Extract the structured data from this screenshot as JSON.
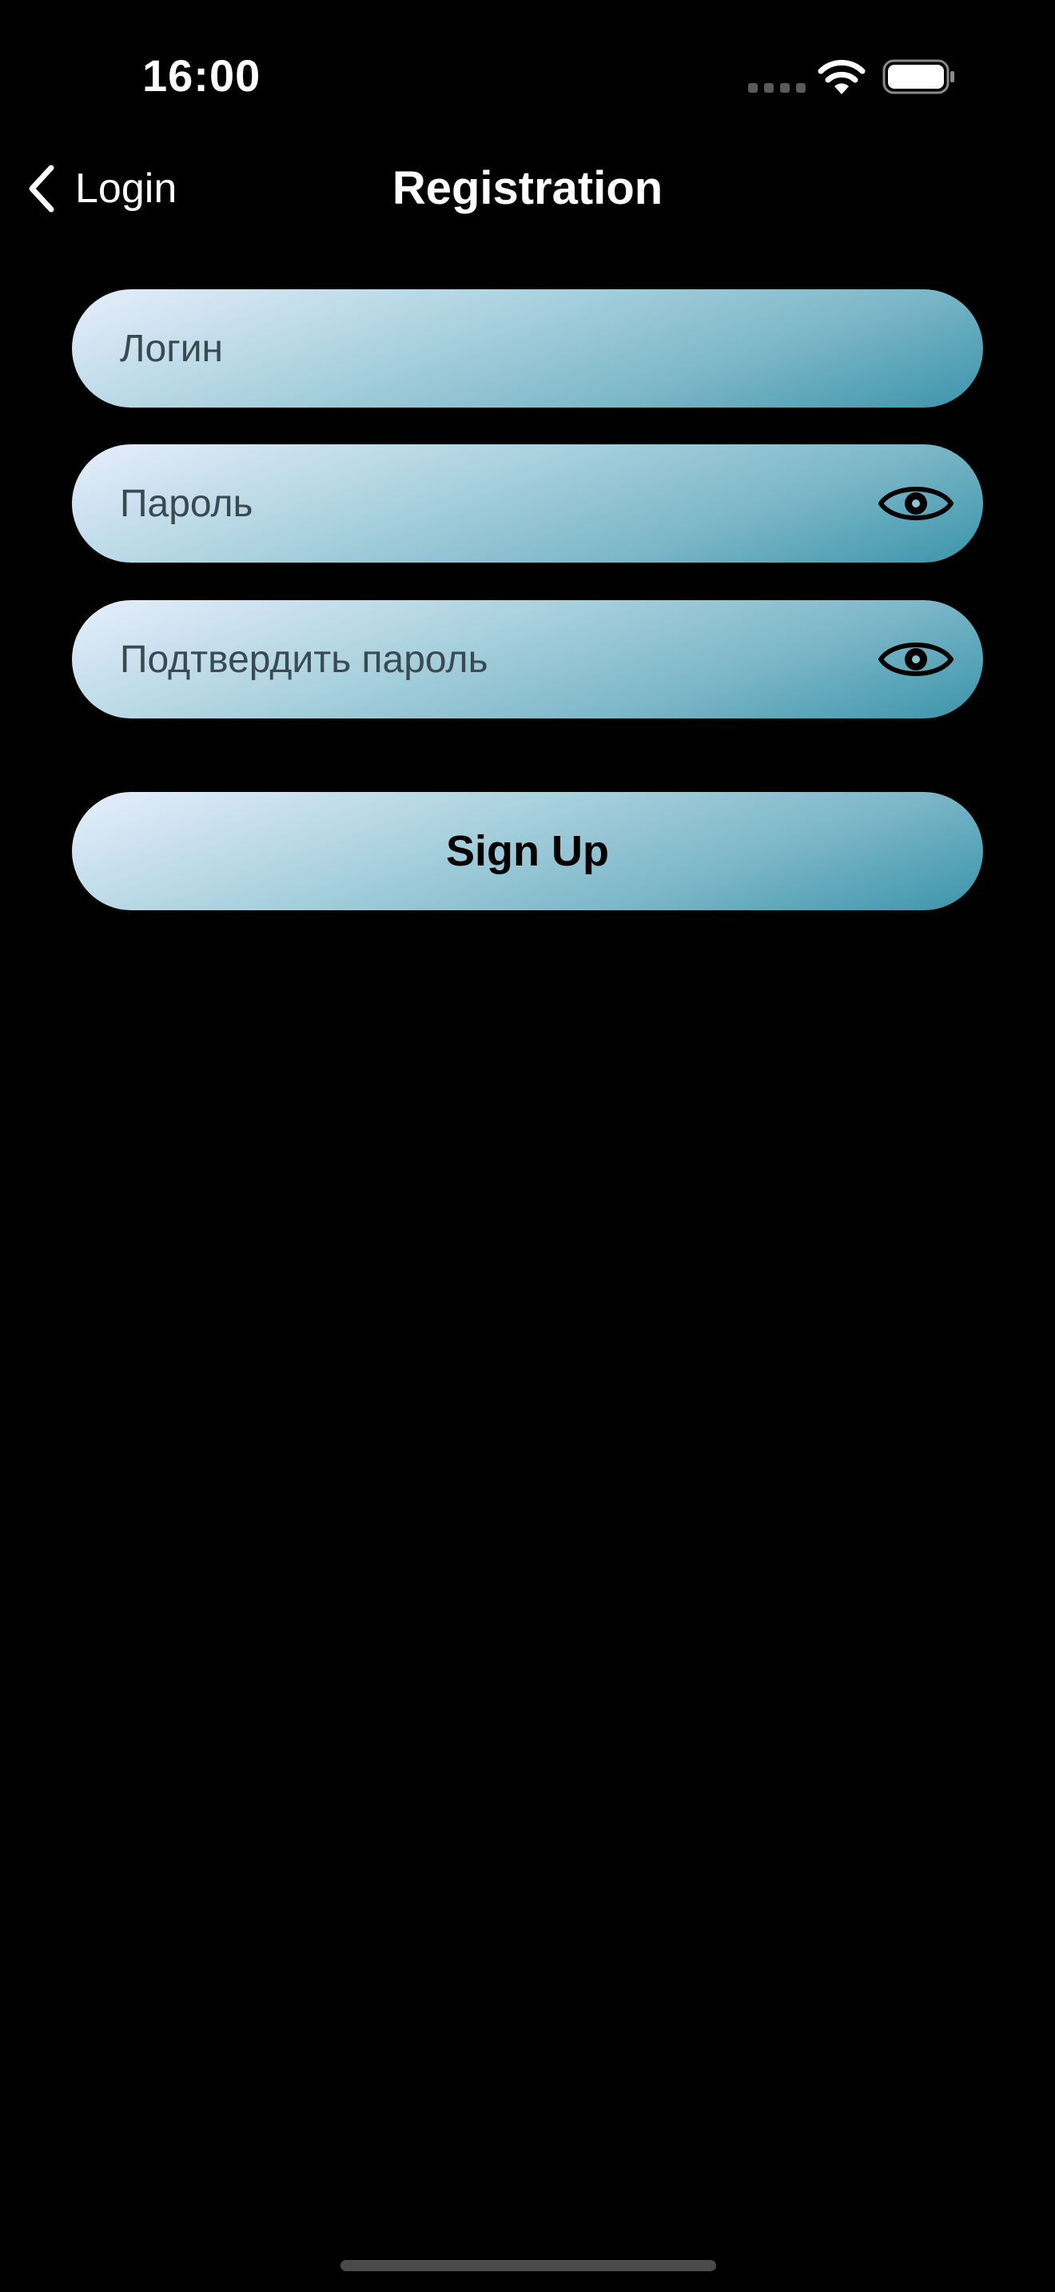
{
  "status_bar": {
    "time": "16:00",
    "colors": {
      "text": "#ffffff",
      "signal_inactive": "#5a5a5a"
    },
    "icons": [
      "cellular-signal-icon",
      "wifi-icon",
      "battery-icon"
    ]
  },
  "nav": {
    "back_label": "Login",
    "back_icon": "chevron-left-icon",
    "title": "Registration"
  },
  "form": {
    "login_placeholder": "Логин",
    "password_placeholder": "Пароль",
    "confirm_password_placeholder": "Подтвердить пароль",
    "visibility_icon": "eye-icon",
    "signup_label": "Sign Up"
  },
  "colors": {
    "background": "#000000",
    "field_gradient": [
      "#e7eefc",
      "#a9d1de",
      "#7cb7c8",
      "#3b94aa"
    ],
    "placeholder_text": "#3a4a52"
  }
}
